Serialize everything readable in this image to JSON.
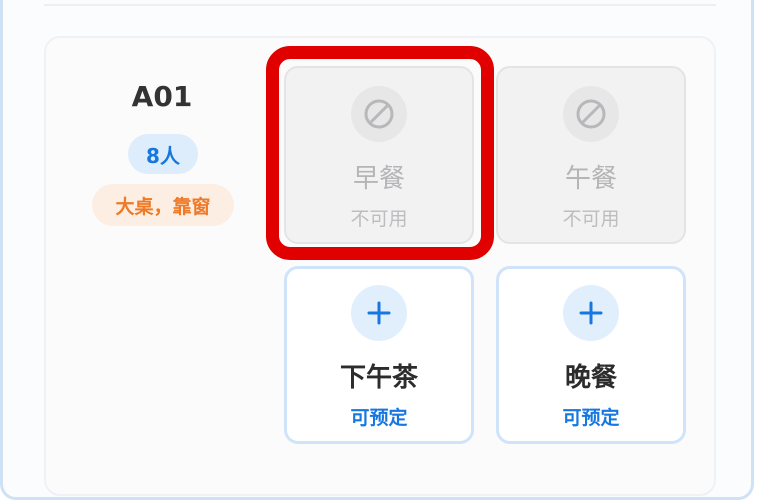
{
  "room": {
    "code": "A01",
    "capacity": "8人",
    "tags": "大桌，靠窗"
  },
  "slots": [
    {
      "name": "早餐",
      "status": "不可用",
      "state": "unavailable",
      "icon": "forbidden-icon"
    },
    {
      "name": "午餐",
      "status": "不可用",
      "state": "unavailable",
      "icon": "forbidden-icon"
    },
    {
      "name": "下午茶",
      "status": "可预定",
      "state": "available",
      "icon": "plus-icon"
    },
    {
      "name": "晚餐",
      "status": "可预定",
      "state": "available",
      "icon": "plus-icon"
    }
  ],
  "colors": {
    "accent": "#1677e0",
    "tag_text": "#ee7a27",
    "highlight": "#e00000"
  }
}
